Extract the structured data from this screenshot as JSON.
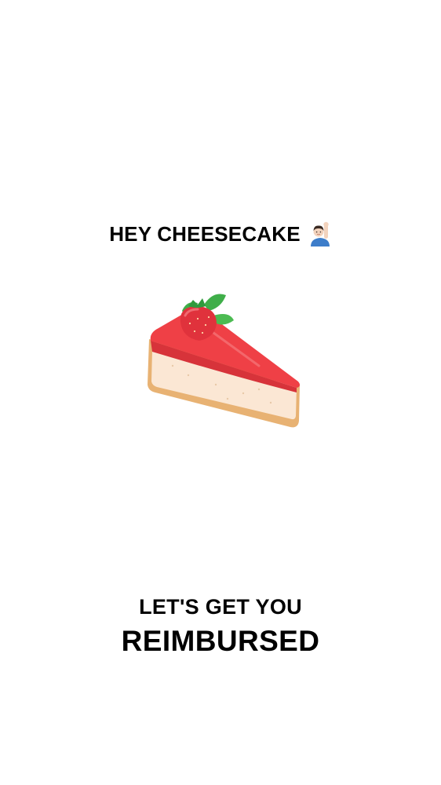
{
  "greeting": {
    "text": "HEY CHEESECAKE",
    "icon": "raised-hand-emoji-icon"
  },
  "hero": {
    "icon": "strawberry-cheesecake-slice-icon"
  },
  "tagline": {
    "line1": "LET'S GET YOU",
    "line2": "REIMBURSED"
  },
  "colors": {
    "background": "#ffffff",
    "text": "#000000",
    "cake_topping": "#ef4046",
    "cake_body": "#fbe7d4",
    "cake_crust": "#e8b273",
    "strawberry": "#e0323c",
    "leaf": "#3fae49"
  }
}
